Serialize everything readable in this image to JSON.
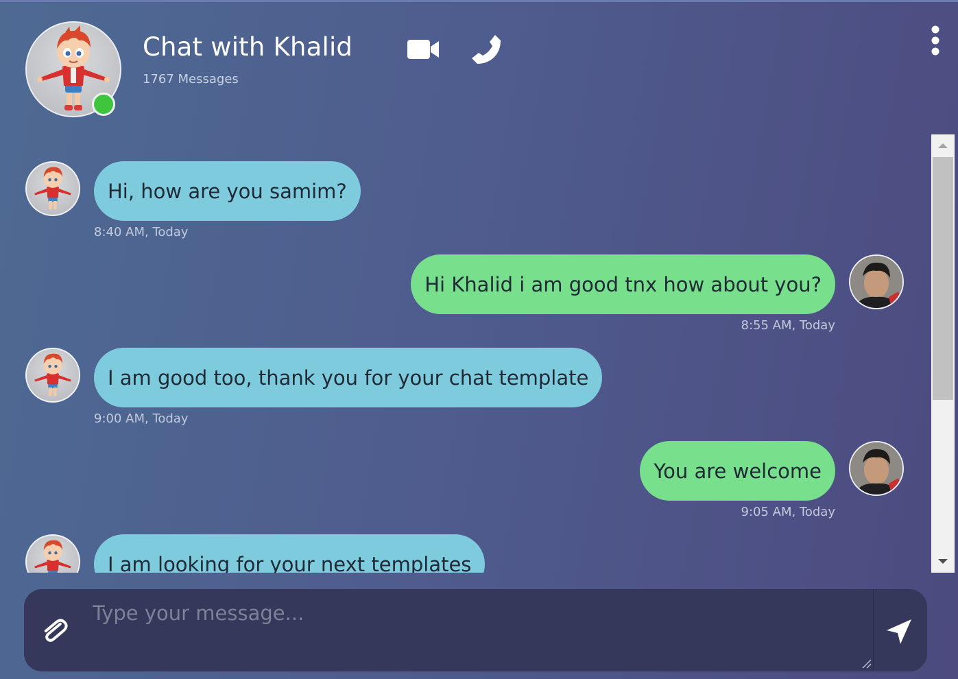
{
  "header": {
    "title": "Chat with Khalid",
    "message_count": "1767 Messages",
    "status": "online",
    "icons": [
      "video-camera-icon",
      "phone-icon",
      "more-vertical-icon"
    ]
  },
  "messages": [
    {
      "sender": "Khalid",
      "direction": "incoming",
      "text": "Hi, how are you samim?",
      "time": "8:40 AM, Today"
    },
    {
      "sender": "samim",
      "direction": "outgoing",
      "text": "Hi Khalid i am good tnx how about you?",
      "time": "8:55 AM, Today"
    },
    {
      "sender": "Khalid",
      "direction": "incoming",
      "text": "I am good too, thank you for your chat template",
      "time": "9:00 AM, Today"
    },
    {
      "sender": "samim",
      "direction": "outgoing",
      "text": "You are welcome",
      "time": "9:05 AM, Today"
    },
    {
      "sender": "Khalid",
      "direction": "incoming",
      "text": "I am looking for your next templates",
      "time": ""
    }
  ],
  "composer": {
    "placeholder": "Type your message...",
    "value": "",
    "icons": [
      "paperclip-icon",
      "send-icon"
    ]
  },
  "colors": {
    "incoming_bubble": "#7ecbdd",
    "outgoing_bubble": "#78df8c",
    "online": "#3ec53d",
    "composer_bg": "#35385a"
  }
}
